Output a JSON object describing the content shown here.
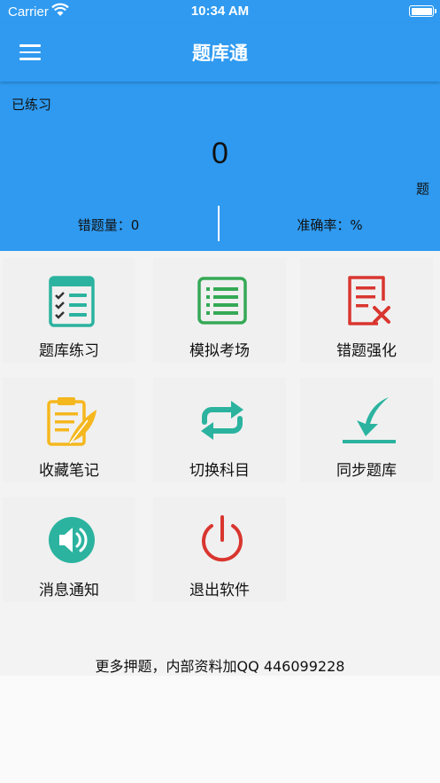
{
  "status": {
    "carrier": "Carrier",
    "time": "10:34 AM"
  },
  "nav": {
    "title": "题库通",
    "menu_icon": "hamburger-menu-icon"
  },
  "stats": {
    "practiced_label": "已练习",
    "count": "0",
    "unit": "题",
    "wrong_label": "错题量：0",
    "accuracy_label": "准确率：%"
  },
  "grid": [
    {
      "label": "题库练习",
      "icon": "checklist-icon",
      "color": "#2bb39f"
    },
    {
      "label": "模拟考场",
      "icon": "list-doc-icon",
      "color": "#35a956"
    },
    {
      "label": "错题强化",
      "icon": "doc-error-icon",
      "color": "#d9362f"
    },
    {
      "label": "收藏笔记",
      "icon": "clipboard-note-icon",
      "color": "#f5b71e"
    },
    {
      "label": "切换科目",
      "icon": "switch-arrows-icon",
      "color": "#2bb39f"
    },
    {
      "label": "同步题库",
      "icon": "download-arrow-icon",
      "color": "#2bb39f"
    },
    {
      "label": "消息通知",
      "icon": "speaker-icon",
      "color": "#2bb39f"
    },
    {
      "label": "退出软件",
      "icon": "power-icon",
      "color": "#d9362f"
    }
  ],
  "footer": "更多押题，内部资料加QQ 446099228"
}
